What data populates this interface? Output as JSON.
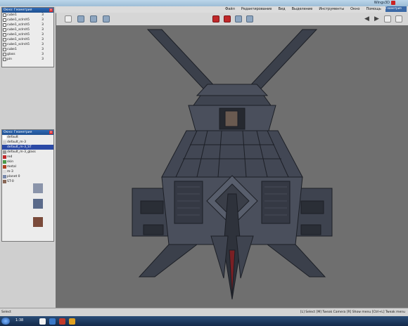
{
  "window": {
    "title": "Wings3D"
  },
  "menu": {
    "items": [
      "Файл",
      "Редактирование",
      "Вид",
      "Выделение",
      "Инструменты",
      "Окно",
      "Помощь"
    ],
    "submenu_label": "Геометрия"
  },
  "outliner": {
    "title": "Окно: Геометрия",
    "items": [
      {
        "label": "cube1",
        "num": "3"
      },
      {
        "label": "cube1_sclrsh5",
        "num": "3"
      },
      {
        "label": "cube1_sclrsh5",
        "num": "3"
      },
      {
        "label": "cube1_sclrsh5",
        "num": "3"
      },
      {
        "label": "cube1_sclrsh5",
        "num": "3"
      },
      {
        "label": "cube1_sclrsh5",
        "num": "3"
      },
      {
        "label": "cube1_sclrsh5",
        "num": "3"
      },
      {
        "label": "cube1",
        "num": "3"
      },
      {
        "label": "glass",
        "num": "3"
      },
      {
        "label": "pin",
        "num": "3"
      }
    ]
  },
  "materials": {
    "title": "Окно: Геометрия",
    "items": [
      {
        "label": "default",
        "color": "#ffffff"
      },
      {
        "label": "default_m-3",
        "color": "#d0d0d0"
      },
      {
        "label": "default_m-3_ST",
        "color": "#2b4aa6",
        "selected": true
      },
      {
        "label": "default_m-3_glass",
        "color": "#999999"
      },
      {
        "label": "red",
        "color": "#c0282a"
      },
      {
        "label": "skin",
        "color": "#4a9a4a"
      },
      {
        "label": "metal",
        "color": "#b04020"
      },
      {
        "label": "m-3",
        "color": "#dddddd"
      },
      {
        "label": "planet 0",
        "color": "#7788aa"
      },
      {
        "label": "ST-0",
        "color": "#886655"
      }
    ]
  },
  "statusbar": {
    "left": "Select",
    "hint": "[L] Select  [M] Tweak Camera  [R] Show menu  [Ctrl+L] Tweak menu"
  },
  "taskbar": {
    "time": "1:38"
  },
  "colors": {
    "viewport_bg": "#6f6f6f",
    "model_dark": "#343844",
    "model_mid": "#4a4f5c",
    "model_light": "#626878",
    "wire": "#1c1f26",
    "accent_red": "#c0282a",
    "title_blue": "#1e4f90"
  },
  "icons": [
    "back-arrow-icon",
    "forward-arrow-icon",
    "view-icon",
    "shade-icon",
    "wire-icon"
  ]
}
